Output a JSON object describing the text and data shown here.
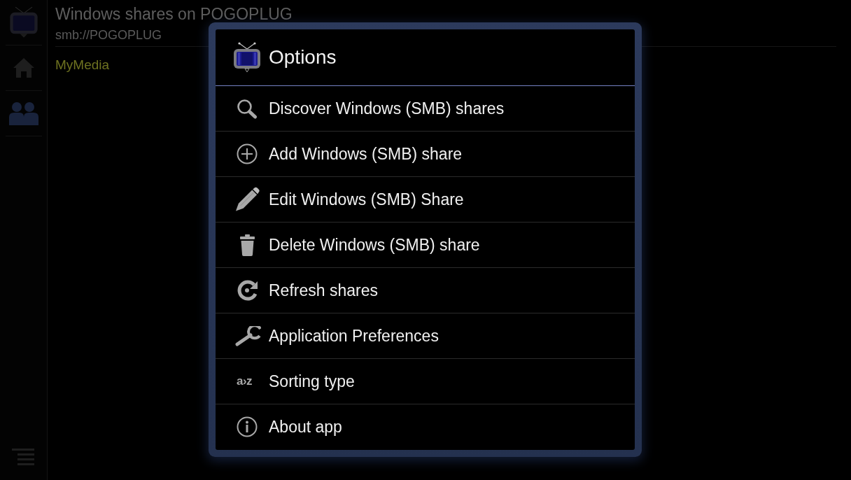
{
  "header": {
    "title": "Windows shares on POGOPLUG",
    "path": "smb://POGOPLUG"
  },
  "shares": [
    {
      "name": "MyMedia"
    }
  ],
  "dialog": {
    "title": "Options",
    "items": [
      {
        "kind": "discover",
        "label": "Discover Windows (SMB) shares"
      },
      {
        "kind": "add",
        "label": "Add Windows (SMB) share"
      },
      {
        "kind": "edit",
        "label": "Edit Windows (SMB) Share"
      },
      {
        "kind": "delete",
        "label": "Delete Windows (SMB) share"
      },
      {
        "kind": "refresh",
        "label": "Refresh shares"
      },
      {
        "kind": "preferences",
        "label": "Application Preferences"
      },
      {
        "kind": "sort",
        "label": "Sorting type",
        "icon_text": "a›z"
      },
      {
        "kind": "about",
        "label": "About app"
      }
    ]
  }
}
